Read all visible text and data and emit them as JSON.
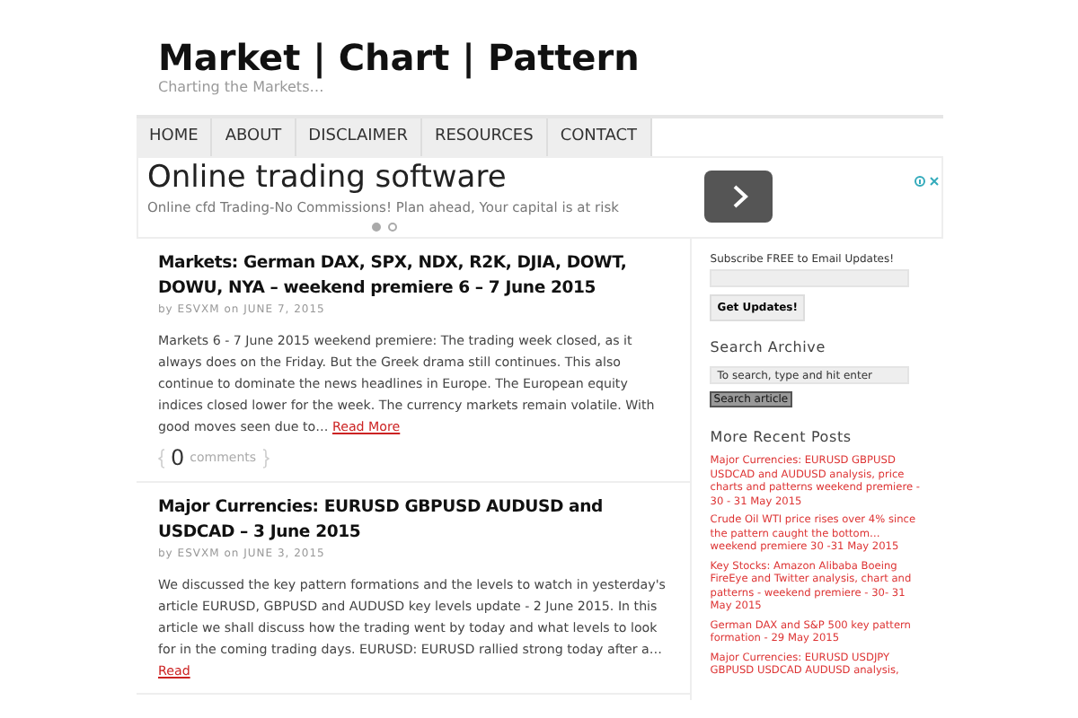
{
  "site": {
    "title": "Market | Chart | Pattern",
    "tagline": "Charting the Markets…"
  },
  "nav": [
    {
      "label": "HOME"
    },
    {
      "label": "ABOUT"
    },
    {
      "label": "DISCLAIMER"
    },
    {
      "label": "RESOURCES"
    },
    {
      "label": "CONTACT"
    }
  ],
  "ad": {
    "title": "Online trading software",
    "text": "Online cfd Trading-No Commissions! Plan ahead, Your capital is at risk",
    "dots": [
      {
        "selected": true
      },
      {
        "selected": false
      }
    ]
  },
  "posts": [
    {
      "title": "Markets: German DAX, SPX, NDX, R2K, DJIA, DOWT, DOWU, NYA – weekend premiere 6 – 7 June 2015",
      "by": "by",
      "author": "ESVXM",
      "on": "on",
      "date": "JUNE 7, 2015",
      "excerpt": "Markets 6 - 7 June 2015 weekend premiere: The trading week closed, as it always does on the Friday. But the Greek drama still continues. This also continue to dominate the news headlines in Europe. The European equity indices closed lower for the week. The currency markets remain volatile. With good moves seen due to…",
      "more": "Read More",
      "comments": "0",
      "comments_label": "comments"
    },
    {
      "title": "Major Currencies: EURUSD GBPUSD AUDUSD and USDCAD – 3 June 2015",
      "by": "by",
      "author": "ESVXM",
      "on": "on",
      "date": "JUNE 3, 2015",
      "excerpt": "We discussed the key pattern formations and the levels to watch in yesterday's article EURUSD, GBPUSD and AUDUSD key levels update - 2 June 2015. In this article we shall discuss how the trading went by today and what levels to look for in the coming trading days. EURUSD: EURUSD rallied strong today after a…",
      "more": "Read"
    }
  ],
  "sidebar": {
    "subscribe_label": "Subscribe FREE to Email Updates!",
    "subscribe_button": "Get Updates!",
    "search_heading": "Search Archive",
    "search_value": "To search, type and hit enter",
    "search_button": "Search article",
    "recent_heading": "More Recent Posts",
    "recent": [
      "Major Currencies: EURUSD GBPUSD USDCAD and AUDUSD analysis, price charts and patterns weekend premiere - 30 - 31 May 2015",
      "Crude Oil WTI price rises over 4% since the pattern caught the bottom… weekend premiere 30 -31 May 2015",
      "Key Stocks: Amazon Alibaba Boeing FireEye and Twitter analysis, chart and patterns - weekend premiere - 30- 31 May 2015",
      "German DAX and S&P 500 key pattern formation - 29 May 2015",
      "Major Currencies: EURUSD USDJPY GBPUSD USDCAD AUDUSD analysis,"
    ]
  }
}
